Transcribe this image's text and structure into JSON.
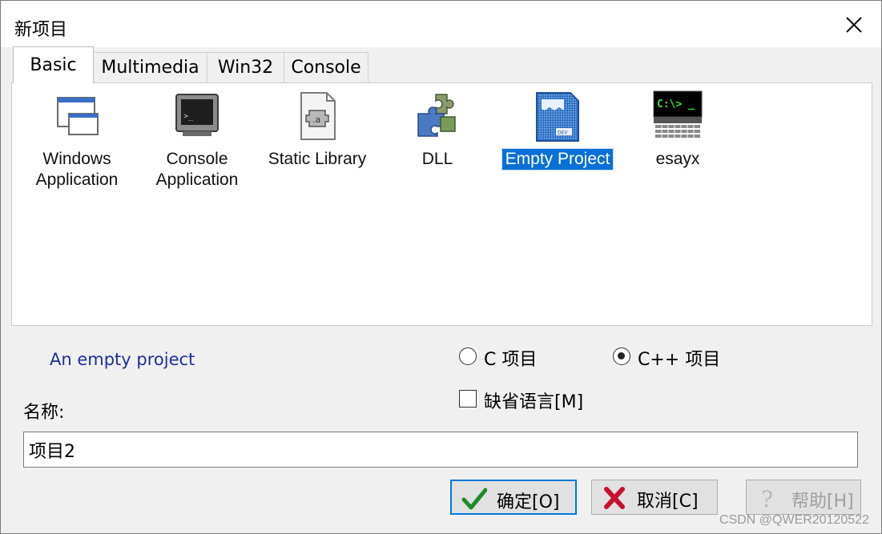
{
  "window": {
    "title": "新项目"
  },
  "tabs": [
    {
      "label": "Basic",
      "active": true
    },
    {
      "label": "Multimedia"
    },
    {
      "label": "Win32"
    },
    {
      "label": "Console"
    }
  ],
  "templates": [
    {
      "label_line1": "Windows",
      "label_line2": "Application",
      "icon": "windows-application-icon"
    },
    {
      "label_line1": "Console",
      "label_line2": "Application",
      "icon": "console-application-icon"
    },
    {
      "label_line1": "Static Library",
      "icon": "static-library-icon"
    },
    {
      "label_line1": "DLL",
      "icon": "dll-puzzle-icon"
    },
    {
      "label_line1": "Empty Project",
      "icon": "empty-project-icon",
      "selected": true
    },
    {
      "label_line1": "esayx",
      "icon": "esayx-terminal-icon",
      "icon_text": "C:\\> _"
    }
  ],
  "description": "An empty project",
  "language": {
    "c_label": "C 项目",
    "cpp_label": "C++ 项目",
    "selected": "C++ 项目",
    "default_lang_label": "缺省语言[M]",
    "default_lang_checked": false
  },
  "name": {
    "label": "名称:",
    "value": "项目2"
  },
  "buttons": {
    "ok_label": "确定[O]",
    "cancel_label": "取消[C]",
    "help_label": "帮助[H]"
  },
  "watermark": "CSDN @QWER20120522",
  "colors": {
    "selection": "#0a6fd6",
    "description_text": "#1d2f9b",
    "default_button_border": "#0078d7"
  }
}
